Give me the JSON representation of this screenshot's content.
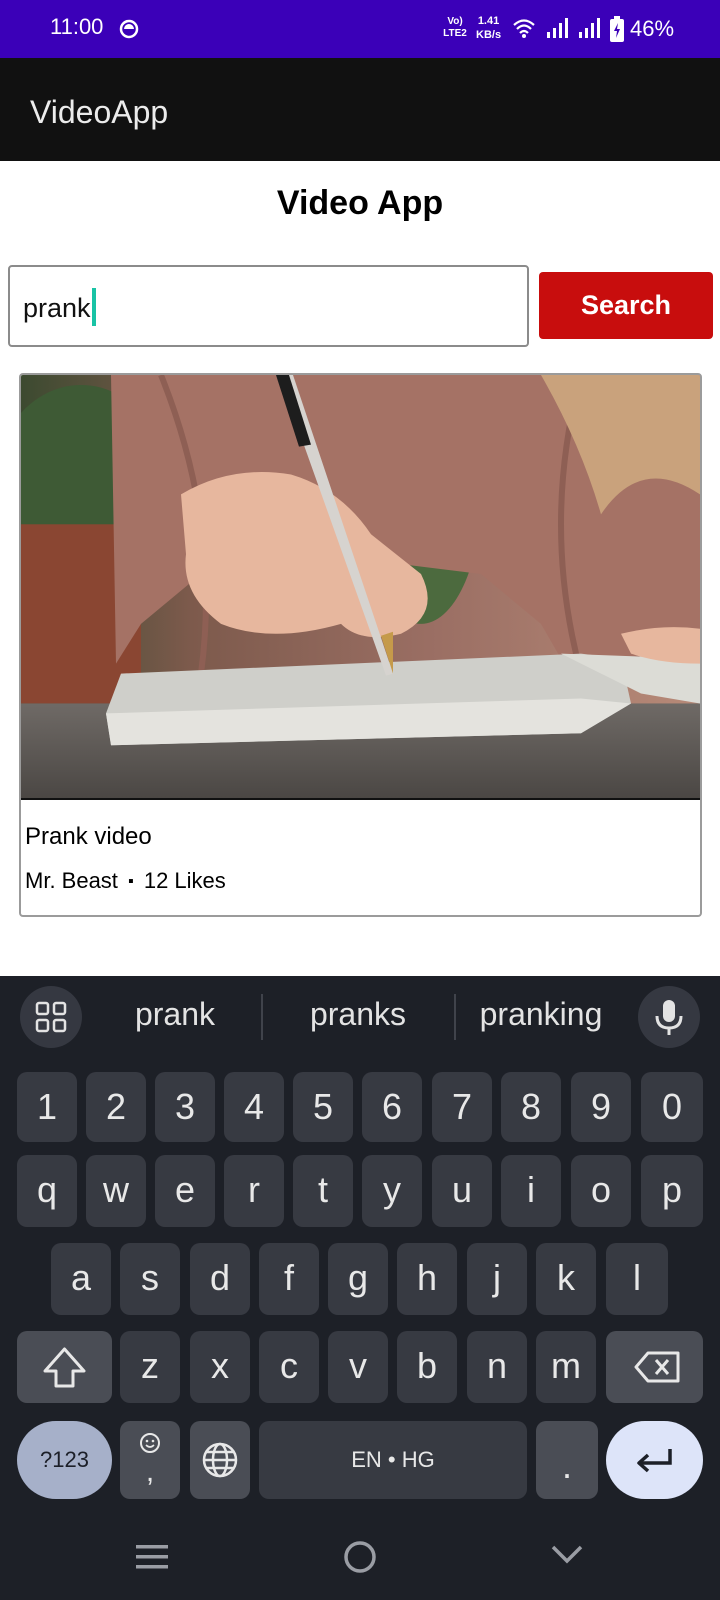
{
  "status_bar": {
    "time": "11:00",
    "network_type": "Vo) LTE2",
    "speed_value": "1.41",
    "speed_unit": "KB/s",
    "battery": "46%",
    "bg_color": "#3b00b8"
  },
  "app_bar": {
    "title": "VideoApp"
  },
  "page": {
    "title": "Video App"
  },
  "search": {
    "value": "prank",
    "button_label": "Search",
    "button_color": "#c80d0d"
  },
  "video": {
    "title": "Prank video",
    "author": "Mr. Beast",
    "separator": "▪",
    "likes": "12 Likes",
    "thumbnail_icon": "photo-hand-writing-in-notebook"
  },
  "keyboard": {
    "suggestions": [
      "prank",
      "pranks",
      "pranking"
    ],
    "number_row": [
      "1",
      "2",
      "3",
      "4",
      "5",
      "6",
      "7",
      "8",
      "9",
      "0"
    ],
    "row1": [
      "q",
      "w",
      "e",
      "r",
      "t",
      "y",
      "u",
      "i",
      "o",
      "p"
    ],
    "row2": [
      "a",
      "s",
      "d",
      "f",
      "g",
      "h",
      "j",
      "k",
      "l"
    ],
    "row3": [
      "z",
      "x",
      "c",
      "v",
      "b",
      "n",
      "m"
    ],
    "symbols_label": "?123",
    "emoji_comma": ",",
    "space_label": "EN • HG",
    "period_label": "."
  }
}
